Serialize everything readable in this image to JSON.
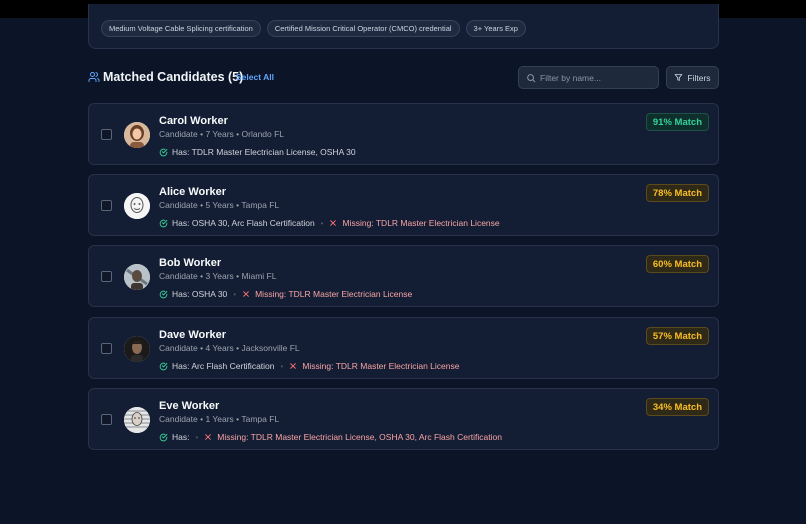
{
  "requirements": {
    "tags": [
      "Medium Voltage Cable Splicing certification",
      "Certified Mission Critical Operator (CMCO) credential",
      "3+ Years Exp"
    ]
  },
  "section": {
    "title": "Matched Candidates (5)",
    "select_all": "Select All",
    "search_placeholder": "Filter by name...",
    "filters_label": "Filters"
  },
  "colors": {
    "good_match": "#34d399",
    "partial_match": "#fbbf24",
    "missing": "#f87171",
    "accent": "#60a5fa"
  },
  "candidates": [
    {
      "name": "Carol Worker",
      "meta": "Candidate • 7 Years • Orlando FL",
      "has": "Has: TDLR Master Electrician License, OSHA 30",
      "missing": "",
      "match": "91% Match",
      "level": "green"
    },
    {
      "name": "Alice Worker",
      "meta": "Candidate • 5 Years • Tampa FL",
      "has": "Has: OSHA 30, Arc Flash Certification",
      "missing": "Missing: TDLR Master Electrician License",
      "match": "78% Match",
      "level": "yellow"
    },
    {
      "name": "Bob Worker",
      "meta": "Candidate • 3 Years • Miami FL",
      "has": "Has: OSHA 30",
      "missing": "Missing: TDLR Master Electrician License",
      "match": "60% Match",
      "level": "yellow"
    },
    {
      "name": "Dave Worker",
      "meta": "Candidate • 4 Years • Jacksonville FL",
      "has": "Has: Arc Flash Certification",
      "missing": "Missing: TDLR Master Electrician License",
      "match": "57% Match",
      "level": "yellow"
    },
    {
      "name": "Eve Worker",
      "meta": "Candidate • 1 Years • Tampa FL",
      "has": "Has:",
      "missing": "Missing: TDLR Master Electrician License, OSHA 30, Arc Flash Certification",
      "match": "34% Match",
      "level": "yellow"
    }
  ]
}
